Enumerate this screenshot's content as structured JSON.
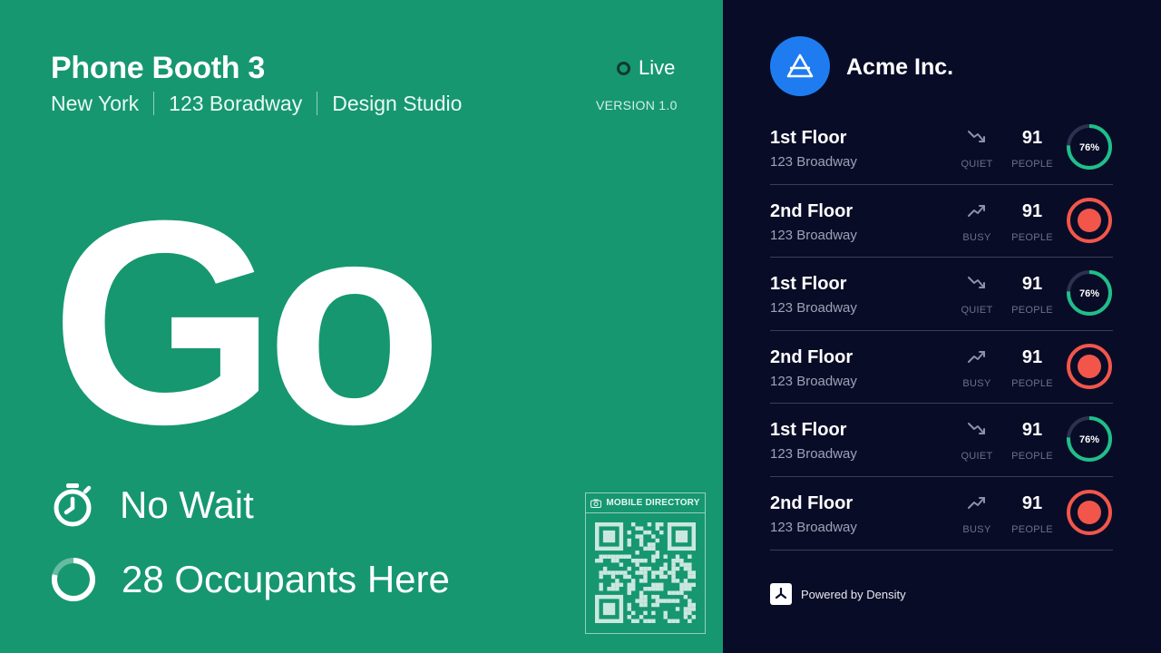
{
  "booth": {
    "title": "Phone Booth 3",
    "city": "New York",
    "address": "123 Boradway",
    "department": "Design Studio",
    "live_label": "Live",
    "version": "VERSION 1.0",
    "big_status": "Go",
    "wait_text": "No Wait",
    "occupants_text": "28 Occupants Here",
    "qr_label": "MOBILE DIRECTORY"
  },
  "company": {
    "name": "Acme Inc."
  },
  "floors": [
    {
      "name": "1st Floor",
      "address": "123 Broadway",
      "trend": "down",
      "status": "QUIET",
      "count": "91",
      "count_label": "PEOPLE",
      "percent_label": "76%",
      "percent": 76,
      "busy": false
    },
    {
      "name": "2nd Floor",
      "address": "123 Broadway",
      "trend": "up",
      "status": "BUSY",
      "count": "91",
      "count_label": "PEOPLE",
      "percent_label": "",
      "percent": 100,
      "busy": true
    },
    {
      "name": "1st Floor",
      "address": "123 Broadway",
      "trend": "down",
      "status": "QUIET",
      "count": "91",
      "count_label": "PEOPLE",
      "percent_label": "76%",
      "percent": 76,
      "busy": false
    },
    {
      "name": "2nd Floor",
      "address": "123 Broadway",
      "trend": "up",
      "status": "BUSY",
      "count": "91",
      "count_label": "PEOPLE",
      "percent_label": "",
      "percent": 100,
      "busy": true
    },
    {
      "name": "1st Floor",
      "address": "123 Broadway",
      "trend": "down",
      "status": "QUIET",
      "count": "91",
      "count_label": "PEOPLE",
      "percent_label": "76%",
      "percent": 76,
      "busy": false
    },
    {
      "name": "2nd Floor",
      "address": "123 Broadway",
      "trend": "up",
      "status": "BUSY",
      "count": "91",
      "count_label": "PEOPLE",
      "percent_label": "",
      "percent": 100,
      "busy": true
    }
  ],
  "footer": {
    "powered_by": "Powered by Density"
  },
  "colors": {
    "green": "#16976f",
    "navy": "#090c27",
    "quiet": "#1fbf8a",
    "busy": "#f2564a",
    "brand_blue": "#1f7cf0"
  },
  "icons": {
    "live": "live-dot-icon",
    "wait": "stopwatch-icon",
    "occupancy": "occupancy-ring-icon",
    "camera": "camera-icon",
    "qr": "qr-code-icon",
    "logo": "acme-logo-icon",
    "trend_up": "trend-up-icon",
    "trend_down": "trend-down-icon",
    "density": "density-logo-icon"
  }
}
